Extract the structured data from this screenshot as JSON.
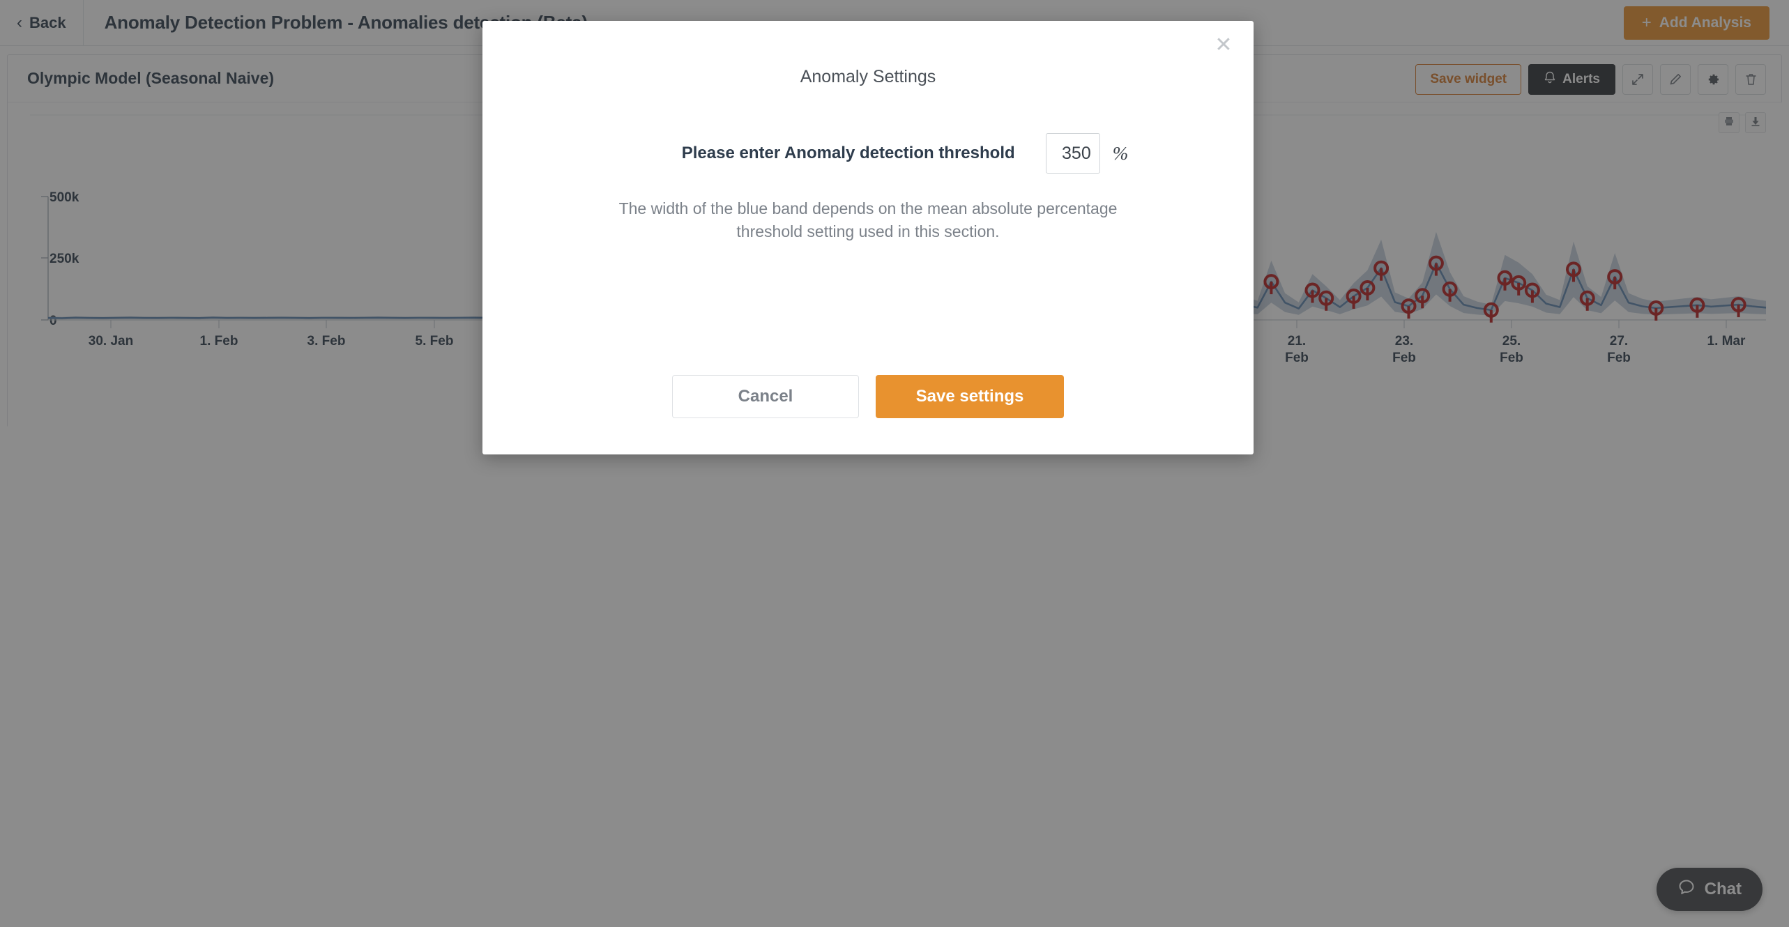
{
  "topbar": {
    "back_label": "Back",
    "back_icon": "chevron-left-icon",
    "page_title": "Anomaly Detection Problem - Anomalies detection (Beta)",
    "add_analysis_label": "Add Analysis",
    "add_analysis_icon": "plus-icon",
    "accent_color": "#e8912d"
  },
  "widget": {
    "title": "Olympic Model (Seasonal Naive)",
    "save_widget_label": "Save widget",
    "alerts_label": "Alerts",
    "alerts_icon": "bell-icon",
    "expand_icon": "expand-arrows-icon",
    "edit_icon": "pencil-icon",
    "settings_icon": "gear-icon",
    "delete_icon": "trash-icon",
    "print_icon": "print-icon",
    "download_icon": "download-icon",
    "save_widget_color": "#d4792a",
    "alerts_bg": "#2b2f33"
  },
  "chart_data": {
    "type": "line",
    "title": "",
    "xlabel": "",
    "ylabel": "",
    "ylim": [
      0,
      560000
    ],
    "yticks": [
      0,
      250000,
      500000
    ],
    "ytick_labels": [
      "0",
      "250k",
      "500k"
    ],
    "xtick_labels": [
      "30. Jan",
      "1. Feb",
      "3. Feb",
      "5. Feb",
      "21. Feb",
      "23. Feb",
      "25. Feb",
      "27. Feb",
      "1. Mar"
    ],
    "xtick_labels_right": [
      "21.\nFeb",
      "23.\nFeb",
      "25.\nFeb",
      "27.\nFeb",
      "1. Mar"
    ],
    "grid": false,
    "legend": "none",
    "series": [
      {
        "name": "actual",
        "color": "#5b83ad",
        "values": [
          8000,
          7000,
          9000,
          8000,
          7500,
          8200,
          9000,
          8000,
          7800,
          8500,
          8000,
          7500,
          9200,
          8000,
          8300,
          7900,
          8200,
          8800,
          8100,
          7600,
          8400,
          8200,
          8000,
          8500,
          9000,
          8300,
          7800,
          8600,
          8200,
          8000,
          8400,
          8900,
          8100,
          7900,
          8300,
          8600,
          8200,
          8000,
          8500,
          8700,
          9000,
          8400,
          8200,
          8800,
          8300,
          8000,
          8600,
          8900,
          8200,
          8500,
          8300,
          9200,
          8400,
          8000,
          8700,
          9000,
          8300,
          8500,
          8800,
          8200,
          9500,
          8600,
          8200,
          9000,
          8400,
          8700,
          9200,
          8500,
          8900,
          9400,
          12000,
          38000,
          18000,
          42000,
          22000,
          95000,
          60000,
          35000,
          88000,
          48000,
          135000,
          72000,
          40000,
          210000,
          96000,
          58000,
          72000,
          62000,
          50000,
          155000,
          70000,
          46000,
          120000,
          88000,
          52000,
          96000,
          130000,
          210000,
          72000,
          56000,
          98000,
          230000,
          125000,
          62000,
          48000,
          40000,
          170000,
          150000,
          120000,
          66000,
          52000,
          205000,
          88000,
          60000,
          175000,
          70000,
          55000,
          48000,
          52000,
          56000,
          60000,
          54000,
          58000,
          62000,
          55000,
          50000
        ]
      },
      {
        "name": "prediction-band",
        "color": "#8fa8c4",
        "band": true
      }
    ],
    "anomalies": {
      "name": "anomalies",
      "color": "#b71c1c",
      "marker": "open-circle",
      "count": 32
    }
  },
  "chat": {
    "label": "Chat",
    "icon": "chat-bubble-icon"
  },
  "modal": {
    "title": "Anomaly Settings",
    "close_icon": "close-icon",
    "threshold_label": "Please enter Anomaly detection threshold",
    "threshold_value": "350",
    "threshold_placeholder": "0",
    "percent_symbol": "%",
    "description": "The width of the blue band depends on the mean absolute percentage threshold setting used in this section.",
    "cancel_label": "Cancel",
    "save_label": "Save settings",
    "save_color": "#e8922f"
  }
}
